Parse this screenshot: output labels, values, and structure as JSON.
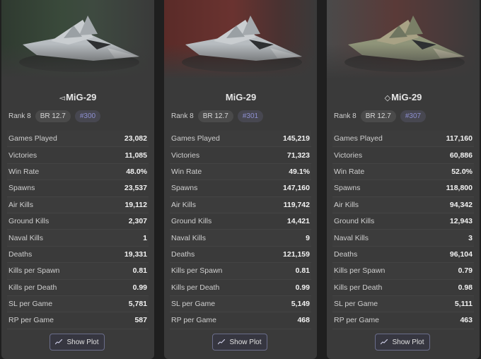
{
  "cards": [
    {
      "flag_glyph": "◅",
      "name": "MiG-29",
      "rank": "Rank 8",
      "br": "BR 12.7",
      "id_badge": "#300",
      "button_label": "Show Plot",
      "stats": [
        {
          "label": "Games Played",
          "value": "23,082"
        },
        {
          "label": "Victories",
          "value": "11,085"
        },
        {
          "label": "Win Rate",
          "value": "48.0%"
        },
        {
          "label": "Spawns",
          "value": "23,537"
        },
        {
          "label": "Air Kills",
          "value": "19,112"
        },
        {
          "label": "Ground Kills",
          "value": "2,307"
        },
        {
          "label": "Naval Kills",
          "value": "1"
        },
        {
          "label": "Deaths",
          "value": "19,331"
        },
        {
          "label": "Kills per Spawn",
          "value": "0.81"
        },
        {
          "label": "Kills per Death",
          "value": "0.99"
        },
        {
          "label": "SL per Game",
          "value": "5,781"
        },
        {
          "label": "RP per Game",
          "value": "587"
        }
      ]
    },
    {
      "flag_glyph": "",
      "name": "MiG-29",
      "rank": "Rank 8",
      "br": "BR 12.7",
      "id_badge": "#301",
      "button_label": "Show Plot",
      "stats": [
        {
          "label": "Games Played",
          "value": "145,219"
        },
        {
          "label": "Victories",
          "value": "71,323"
        },
        {
          "label": "Win Rate",
          "value": "49.1%"
        },
        {
          "label": "Spawns",
          "value": "147,160"
        },
        {
          "label": "Air Kills",
          "value": "119,742"
        },
        {
          "label": "Ground Kills",
          "value": "14,421"
        },
        {
          "label": "Naval Kills",
          "value": "9"
        },
        {
          "label": "Deaths",
          "value": "121,159"
        },
        {
          "label": "Kills per Spawn",
          "value": "0.81"
        },
        {
          "label": "Kills per Death",
          "value": "0.99"
        },
        {
          "label": "SL per Game",
          "value": "5,149"
        },
        {
          "label": "RP per Game",
          "value": "468"
        }
      ]
    },
    {
      "flag_glyph": "◇",
      "name": "MiG-29",
      "rank": "Rank 8",
      "br": "BR 12.7",
      "id_badge": "#307",
      "button_label": "Show Plot",
      "stats": [
        {
          "label": "Games Played",
          "value": "117,160"
        },
        {
          "label": "Victories",
          "value": "60,886"
        },
        {
          "label": "Win Rate",
          "value": "52.0%"
        },
        {
          "label": "Spawns",
          "value": "118,800"
        },
        {
          "label": "Air Kills",
          "value": "94,342"
        },
        {
          "label": "Ground Kills",
          "value": "12,943"
        },
        {
          "label": "Naval Kills",
          "value": "3"
        },
        {
          "label": "Deaths",
          "value": "96,104"
        },
        {
          "label": "Kills per Spawn",
          "value": "0.79"
        },
        {
          "label": "Kills per Death",
          "value": "0.98"
        },
        {
          "label": "SL per Game",
          "value": "5,111"
        },
        {
          "label": "RP per Game",
          "value": "463"
        }
      ]
    }
  ]
}
